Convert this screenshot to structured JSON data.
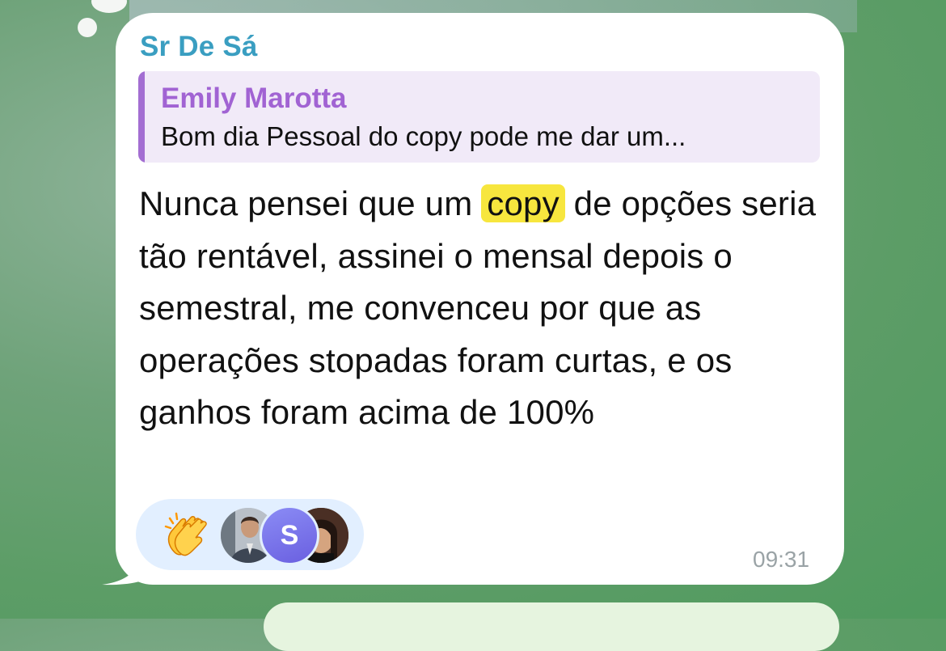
{
  "message": {
    "sender": "Sr De Sá",
    "reply": {
      "author": "Emily Marotta",
      "text": "Bom dia Pessoal do copy pode me dar um..."
    },
    "text_before": "Nunca pensei que um ",
    "highlight": "copy",
    "text_after": " de opções seria tão rentável, assinei o mensal depois o semestral, me convenceu por que as operações stopadas foram curtas, e os ganhos foram acima de 100%",
    "time": "09:31",
    "reactions": {
      "emoji": "clapping-hands",
      "avatars": [
        "photo-man",
        "S",
        "photo-woman"
      ]
    }
  },
  "colors": {
    "sender": "#3a9ec1",
    "reply_author": "#a163d3",
    "reply_bg": "#f1eaf8",
    "highlight": "#f7e63e",
    "reaction_bg": "#e2efff"
  }
}
